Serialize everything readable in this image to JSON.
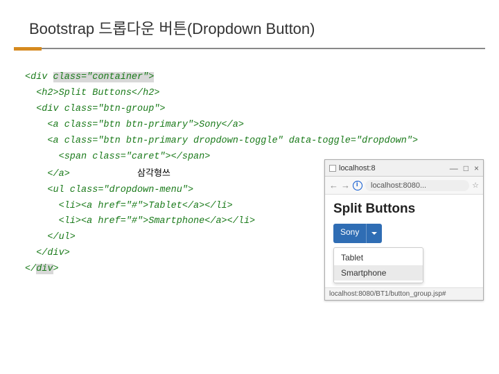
{
  "title": "Bootstrap 드롭다운 버튼(Dropdown Button)",
  "code": {
    "l1a": "<div ",
    "l1b": "class=\"container\">",
    "l2": "  <h2>Split Buttons</h2>",
    "l3": "  <div class=\"btn-group\">",
    "l4": "    <a class=\"btn btn-primary\">Sony</a>",
    "l5": "    <a class=\"btn btn-primary dropdown-toggle\" data-toggle=\"dropdown\">",
    "l6": "      <span class=\"caret\"></span>",
    "l7a": "    </a>",
    "l7note": "삼각형쓰",
    "l8": "    <ul class=\"dropdown-menu\">",
    "l9": "      <li><a href=\"#\">Tablet</a></li>",
    "l10": "      <li><a href=\"#\">Smartphone</a></li>",
    "l11": "    </ul>",
    "l12": "  </div>",
    "l13a": "</",
    "l13b": "div",
    "l13c": ">"
  },
  "preview": {
    "tab_label": "localhost:8",
    "addr": "localhost:8080...",
    "heading": "Split Buttons",
    "main_btn": "Sony",
    "items": {
      "i1": "Tablet",
      "i2": "Smartphone"
    },
    "status": "localhost:8080/BT1/button_group.jsp#"
  }
}
